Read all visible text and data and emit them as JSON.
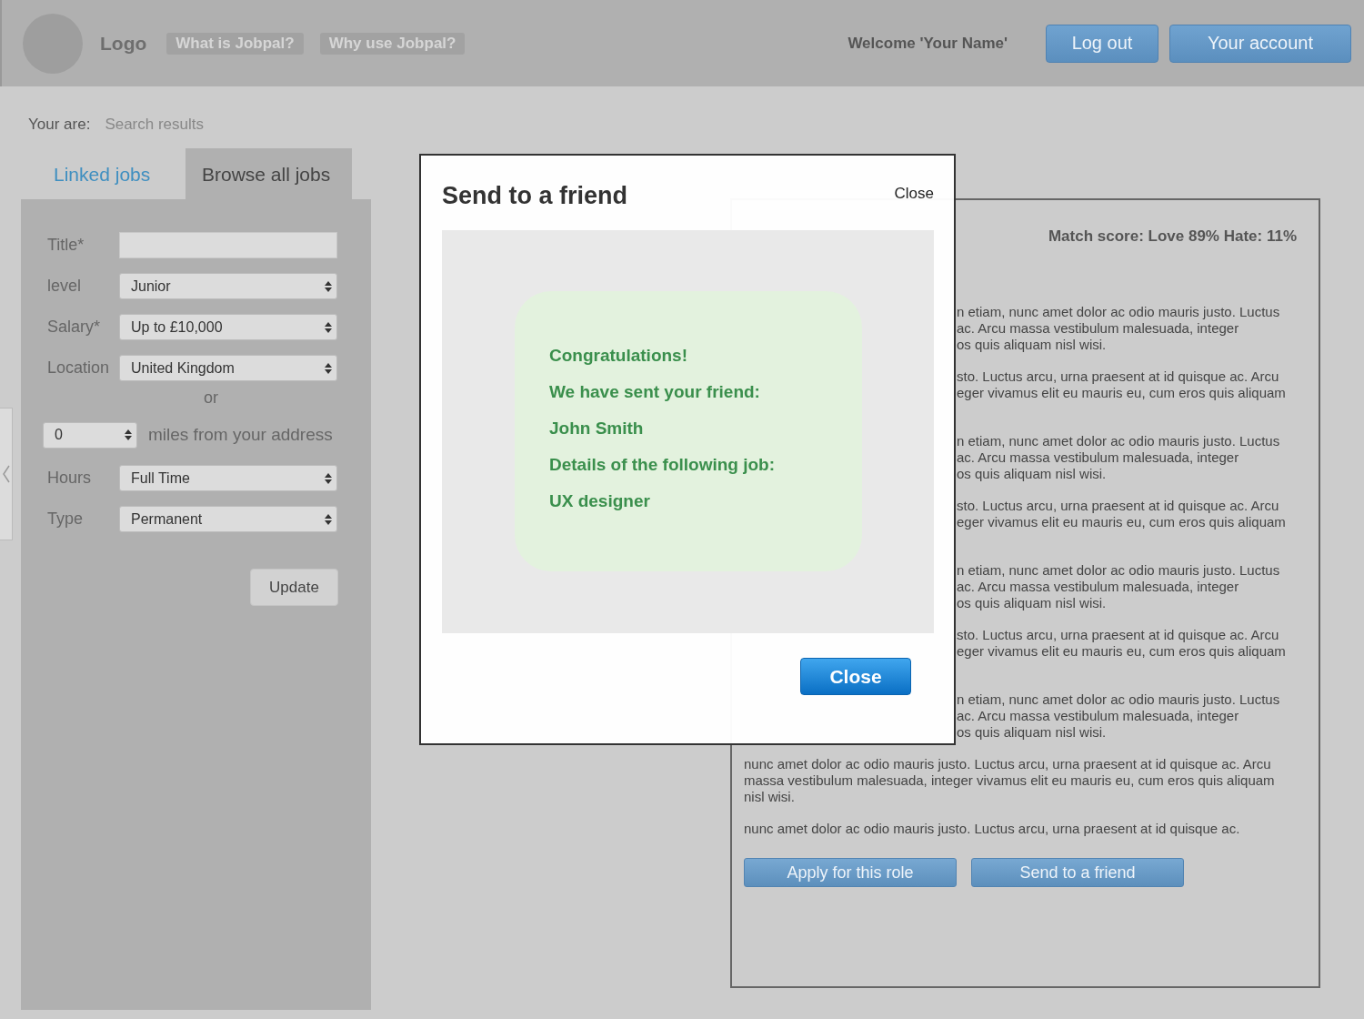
{
  "header": {
    "logo": "Logo",
    "nav_links": [
      "What is Jobpal?",
      "Why use Jobpal?"
    ],
    "welcome": "Welcome 'Your Name'",
    "buttons": [
      "Log out",
      "Your account"
    ]
  },
  "breadcrumb": {
    "label": "Your are:",
    "value": "Search results"
  },
  "tabs": [
    {
      "label": "Linked jobs",
      "selected": false
    },
    {
      "label": "Browse all jobs",
      "selected": true
    }
  ],
  "form": {
    "fields": [
      {
        "kind": "text",
        "label": "Title*"
      },
      {
        "kind": "select",
        "label": "level",
        "value": "Junior"
      },
      {
        "kind": "select",
        "label": "Salary*",
        "value": "Up to £10,000"
      },
      {
        "kind": "select",
        "label": "Location",
        "value": "United Kingdom"
      },
      {
        "kind": "separator",
        "label": "or"
      },
      {
        "kind": "distance",
        "value": "0",
        "label": "miles from your address"
      },
      {
        "kind": "select",
        "label": "Hours",
        "value": "Full Time"
      },
      {
        "kind": "select",
        "label": "Type",
        "value": "Permanent"
      }
    ],
    "button": "Update"
  },
  "job": {
    "match_score": "Match score: Love 89% Hate: 11%",
    "partial_paragraphs": [
      [
        "n etiam, nunc amet dolor ac odio mauris justo. Luctus",
        "ac. Arcu massa vestibulum malesuada, integer",
        "os quis aliquam nisl wisi."
      ],
      [
        "sto. Luctus arcu, urna praesent at id quisque ac. Arcu",
        "eger vivamus elit eu mauris eu, cum eros quis aliquam"
      ],
      [
        "n etiam, nunc amet dolor ac odio mauris justo. Luctus",
        "ac. Arcu massa vestibulum malesuada, integer",
        "os quis aliquam nisl wisi."
      ],
      [
        "sto. Luctus arcu, urna praesent at id quisque ac. Arcu",
        "eger vivamus elit eu mauris eu, cum eros quis aliquam"
      ],
      [
        "n etiam, nunc amet dolor ac odio mauris justo. Luctus",
        "ac. Arcu massa vestibulum malesuada, integer",
        "os quis aliquam nisl wisi."
      ],
      [
        "sto. Luctus arcu, urna praesent at id quisque ac. Arcu",
        "eger vivamus elit eu mauris eu, cum eros quis aliquam"
      ],
      [
        "n etiam, nunc amet dolor ac odio mauris justo. Luctus",
        "ac. Arcu massa vestibulum malesuada, integer",
        "os quis aliquam nisl wisi."
      ]
    ],
    "paragraphs": [
      "nunc amet dolor ac odio mauris justo. Luctus arcu, urna praesent at id quisque ac. Arcu massa vestibulum malesuada, integer vivamus elit eu mauris eu, cum eros quis aliquam nisl wisi.",
      "nunc amet dolor ac odio mauris justo. Luctus arcu, urna praesent at id quisque ac."
    ],
    "buttons": [
      "Apply for this role",
      "Send to a friend"
    ]
  },
  "modal": {
    "title": "Send to a friend",
    "close_link": "Close",
    "message": [
      "Congratulations!",
      "We have sent your friend:",
      "John Smith",
      "Details of the following job:",
      "UX designer"
    ],
    "close_button": "Close"
  }
}
